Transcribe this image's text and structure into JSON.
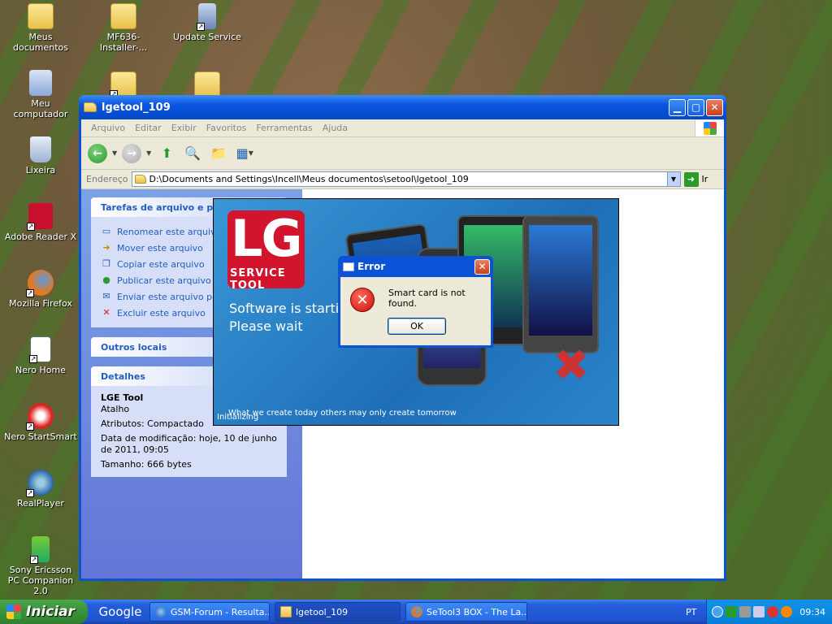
{
  "desktop": {
    "icons": [
      {
        "label": "Meus documentos"
      },
      {
        "label": "MF636-Installer-..."
      },
      {
        "label": "Update Service"
      },
      {
        "label": "Meu computador"
      },
      {
        "label": "Lixeira"
      },
      {
        "label": "Adobe Reader X"
      },
      {
        "label": "Mozilla Firefox"
      },
      {
        "label": "Nero Home"
      },
      {
        "label": "Nero StartSmart"
      },
      {
        "label": "RealPlayer"
      },
      {
        "label": "Sony Ericsson PC Companion 2.0"
      }
    ]
  },
  "explorer": {
    "title": "lgetool_109",
    "menu": [
      "Arquivo",
      "Editar",
      "Exibir",
      "Favoritos",
      "Ferramentas",
      "Ajuda"
    ],
    "address_label": "Endereço",
    "address": "D:\\Documents and Settings\\Incell\\Meus documentos\\setool\\lgetool_109",
    "go_label": "Ir",
    "tasks_header": "Tarefas de arquivo e pas",
    "tasks": [
      "Renomear este arquivo",
      "Mover este arquivo",
      "Copiar este arquivo",
      "Publicar este arquivo na",
      "Enviar este arquivo por",
      "Excluir este arquivo"
    ],
    "other_places_header": "Outros locais",
    "details_header": "Detalhes",
    "details": {
      "name": "LGE Tool",
      "type": "Atalho",
      "attributes": "Atributos: Compactado",
      "modified": "Data de modificação: hoje, 10 de junho de 2011, 09:05",
      "size": "Tamanho: 666 bytes"
    }
  },
  "splash": {
    "logo_big": "LG",
    "logo_sub": "SERVICE TOOL",
    "line1": "Software is starting",
    "line2": "Please wait",
    "tagline": "What we create today others may only create tomorrow",
    "status": "Initializing"
  },
  "error_dialog": {
    "title": "Error",
    "message": "Smart card is not found.",
    "ok_label": "OK"
  },
  "taskbar": {
    "start_label": "Iniciar",
    "google_label": "Google",
    "tasks": [
      "GSM-Forum - Resulta...",
      "lgetool_109",
      "SeTool3 BOX - The La..."
    ],
    "language": "PT",
    "clock": "09:34"
  }
}
